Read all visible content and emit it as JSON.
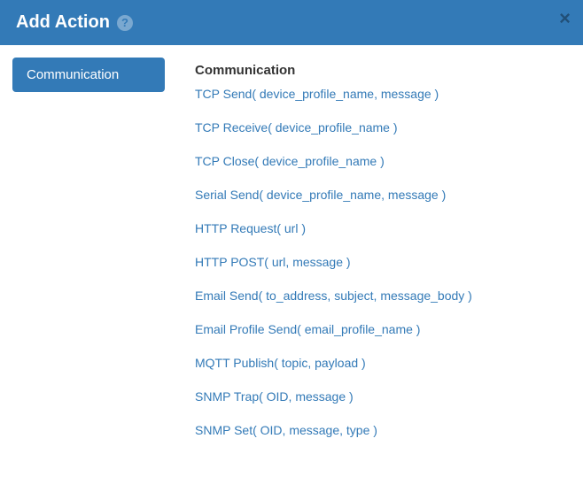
{
  "header": {
    "title": "Add Action",
    "help_icon_label": "?",
    "close_label": "×"
  },
  "sidebar": {
    "items": [
      {
        "label": "Communication"
      }
    ]
  },
  "content": {
    "section_title": "Communication",
    "actions": [
      {
        "label": "TCP Send( device_profile_name, message )"
      },
      {
        "label": "TCP Receive( device_profile_name )"
      },
      {
        "label": "TCP Close( device_profile_name )"
      },
      {
        "label": "Serial Send( device_profile_name, message )"
      },
      {
        "label": "HTTP Request( url )"
      },
      {
        "label": "HTTP POST( url, message )"
      },
      {
        "label": "Email Send( to_address, subject, message_body )"
      },
      {
        "label": "Email Profile Send( email_profile_name )"
      },
      {
        "label": "MQTT Publish( topic, payload )"
      },
      {
        "label": "SNMP Trap( OID, message )"
      },
      {
        "label": "SNMP Set( OID, message, type )"
      }
    ]
  }
}
